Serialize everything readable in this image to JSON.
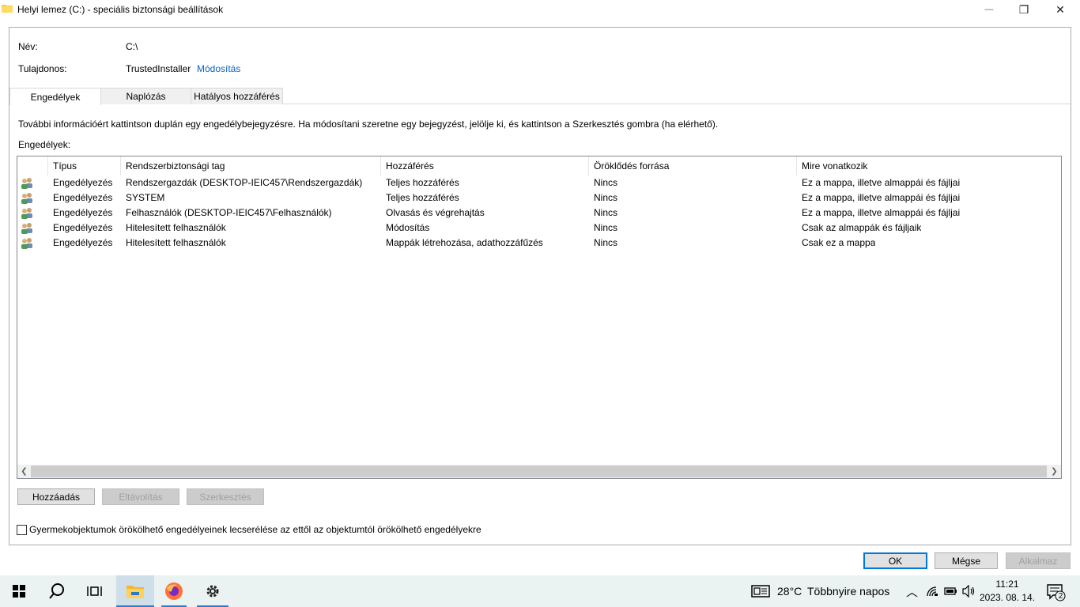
{
  "window": {
    "title": "Helyi lemez (C:) - speciális biztonsági beállítások",
    "controls": {
      "minimize": "—",
      "maximize": "❐",
      "close": "✕"
    }
  },
  "info": {
    "name_label": "Név:",
    "name_value": "C:\\",
    "owner_label": "Tulajdonos:",
    "owner_value": "TrustedInstaller",
    "owner_change_link": "Módosítás"
  },
  "tabs": [
    {
      "label": "Engedélyek",
      "active": true
    },
    {
      "label": "Naplózás",
      "active": false
    },
    {
      "label": "Hatályos hozzáférés",
      "active": false
    }
  ],
  "instructions": "További információért kattintson duplán egy engedélybejegyzésre. Ha módosítani szeretne egy bejegyzést, jelölje ki, és kattintson a Szerkesztés gombra (ha elérhető).",
  "permissions_label": "Engedélyek:",
  "table": {
    "columns": [
      "Típus",
      "Rendszerbiztonsági tag",
      "Hozzáférés",
      "Öröklődés forrása",
      "Mire vonatkozik"
    ],
    "rows": [
      {
        "type": "Engedélyezés",
        "principal": "Rendszergazdák (DESKTOP-IEIC457\\Rendszergazdák)",
        "access": "Teljes hozzáférés",
        "inherited": "Nincs",
        "applies": "Ez a mappa, illetve almappái és fájljai"
      },
      {
        "type": "Engedélyezés",
        "principal": "SYSTEM",
        "access": "Teljes hozzáférés",
        "inherited": "Nincs",
        "applies": "Ez a mappa, illetve almappái és fájljai"
      },
      {
        "type": "Engedélyezés",
        "principal": "Felhasználók (DESKTOP-IEIC457\\Felhasználók)",
        "access": "Olvasás és végrehajtás",
        "inherited": "Nincs",
        "applies": "Ez a mappa, illetve almappái és fájljai"
      },
      {
        "type": "Engedélyezés",
        "principal": "Hitelesített felhasználók",
        "access": "Módosítás",
        "inherited": "Nincs",
        "applies": "Csak az almappák és fájljaik"
      },
      {
        "type": "Engedélyezés",
        "principal": "Hitelesített felhasználók",
        "access": "Mappák létrehozása, adathozzáfűzés",
        "inherited": "Nincs",
        "applies": "Csak ez a mappa"
      }
    ]
  },
  "buttons": {
    "add": "Hozzáadás",
    "remove": "Eltávolítás",
    "edit": "Szerkesztés",
    "ok": "OK",
    "cancel": "Mégse",
    "apply": "Alkalmaz"
  },
  "checkbox": {
    "label": "Gyermekobjektumok örökölhető engedélyeinek lecserélése az ettől az objektumtól örökölhető engedélyekre",
    "checked": false
  },
  "taskbar": {
    "weather_temp": "28°C",
    "weather_text": "Többnyire napos",
    "time": "11:21",
    "date": "2023. 08. 14.",
    "notification_count": "2"
  },
  "colors": {
    "accent": "#0078d7",
    "link": "#0066cc",
    "taskbar": "#eaf2f2"
  }
}
